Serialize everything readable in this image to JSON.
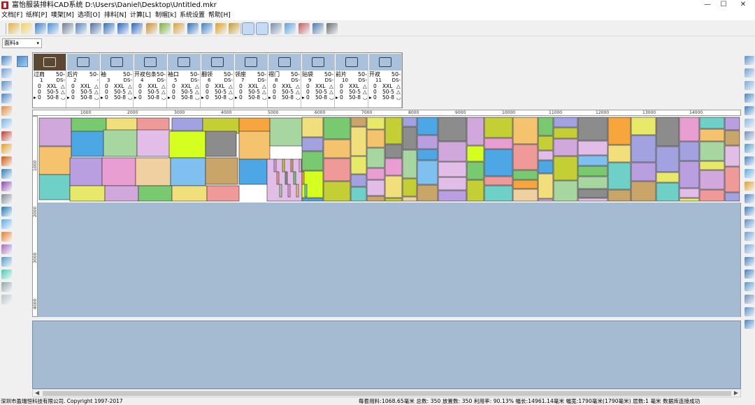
{
  "window": {
    "title": "富怡服装排料CAD系统 D:\\Users\\Daniel\\Desktop\\Untitled.mkr",
    "minimize": "—",
    "maximize": "☐",
    "close": "✕"
  },
  "menu": [
    {
      "label": "文档[F]"
    },
    {
      "label": "纸样[P]"
    },
    {
      "label": "唛架[M]"
    },
    {
      "label": "选项[O]"
    },
    {
      "label": "排料[N]"
    },
    {
      "label": "计算[L]"
    },
    {
      "label": "制帽[k]"
    },
    {
      "label": "系统设置"
    },
    {
      "label": "帮助[H]"
    }
  ],
  "toolbar": {
    "icons": [
      "open-folder-icon",
      "new-file-icon",
      "import-icon",
      "save-as-icon",
      "print-icon",
      "plot-icon",
      "print-preview-icon",
      "marker-settings-icon",
      "undo-icon",
      "redo-icon",
      "piece-tool-icon",
      "measure-icon",
      "tape-icon",
      "circle-icon",
      "table-icon",
      "text-icon",
      "image-icon",
      "view-single-icon",
      "view-double-icon",
      "grid-icon",
      "triangle-icon",
      "palette-icon",
      "export-icon",
      "delete-icon"
    ],
    "pressed": [
      17,
      18
    ]
  },
  "fabric_select": {
    "value": "面料a",
    "arrow": "▾"
  },
  "pieces": [
    {
      "name": "过肩",
      "size": "50-",
      "num": "1",
      "ds": "DS-",
      "qty": [
        [
          "0",
          "XXL",
          "△"
        ],
        [
          "0",
          "50-5",
          "△"
        ],
        [
          "0",
          "50-8",
          "◡"
        ]
      ]
    },
    {
      "name": "后片",
      "size": "50-",
      "num": "2",
      "ds": "-",
      "qty": [
        [
          "0",
          "XXL",
          "△"
        ],
        [
          "0",
          "50-5",
          "△"
        ],
        [
          "0",
          "50-8",
          "◡"
        ]
      ]
    },
    {
      "name": "袖",
      "size": "50-",
      "num": "3",
      "ds": "DS-",
      "qty": [
        [
          "0",
          "XXL",
          "△"
        ],
        [
          "0",
          "50-5",
          "△"
        ],
        [
          "0",
          "50-8",
          "◡"
        ]
      ]
    },
    {
      "name": "开衩包条",
      "size": "50-",
      "num": "4",
      "ds": "DS-",
      "qty": [
        [
          "0",
          "XXL",
          "△"
        ],
        [
          "0",
          "50-5",
          "△"
        ],
        [
          "0",
          "50-8",
          "◡"
        ]
      ]
    },
    {
      "name": "袖口",
      "size": "50-",
      "num": "5",
      "ds": "DS-",
      "qty": [
        [
          "0",
          "XXL",
          "△"
        ],
        [
          "0",
          "50-5",
          "△"
        ],
        [
          "0",
          "50-8",
          "◡"
        ]
      ]
    },
    {
      "name": "翻领",
      "size": "50-",
      "num": "6",
      "ds": "DS-",
      "qty": [
        [
          "0",
          "XXL",
          "△"
        ],
        [
          "0",
          "50-5",
          "△"
        ],
        [
          "0",
          "50-8",
          "◡"
        ]
      ]
    },
    {
      "name": "领座",
      "size": "50-",
      "num": "7",
      "ds": "DS-",
      "qty": [
        [
          "0",
          "XXL",
          "△"
        ],
        [
          "0",
          "50-5",
          "△"
        ],
        [
          "0",
          "50-8",
          "◡"
        ]
      ]
    },
    {
      "name": "褶门",
      "size": "50-",
      "num": "8",
      "ds": "DS-",
      "qty": [
        [
          "0",
          "XXL",
          "△"
        ],
        [
          "0",
          "50-5",
          "△"
        ],
        [
          "0",
          "50-8",
          "◡"
        ]
      ]
    },
    {
      "name": "贴袋",
      "size": "50-",
      "num": "9",
      "ds": "DS-",
      "qty": [
        [
          "0",
          "XXL",
          "△"
        ],
        [
          "0",
          "50-5",
          "△"
        ],
        [
          "0",
          "50-8",
          "◡"
        ]
      ]
    },
    {
      "name": "前片",
      "size": "50-",
      "num": "10",
      "ds": "DS-",
      "qty": [
        [
          "0",
          "XXL",
          "△"
        ],
        [
          "0",
          "50-5",
          "△"
        ],
        [
          "0",
          "50-8",
          "◡"
        ]
      ]
    },
    {
      "name": "开衩",
      "size": "50-",
      "num": "11",
      "ds": "DS-",
      "qty": [
        [
          "0",
          "XXL",
          "△"
        ],
        [
          "0",
          "50-5",
          "△"
        ],
        [
          "0",
          "50-8",
          "◡"
        ]
      ]
    }
  ],
  "ruler": {
    "horizontal": [
      "1000",
      "2000",
      "3000",
      "4000",
      "5000",
      "6000",
      "7000",
      "8000",
      "9000",
      "10000",
      "11000",
      "12000",
      "13000",
      "14000"
    ],
    "vertical": [
      "1000",
      "2000",
      "3000",
      "4000"
    ]
  },
  "status": {
    "copyright": "深圳市盈瑞恒科技有限公司. Copyright 1997-2017",
    "info": "每套用料:1068.65毫米 总数: 350 放置数: 350 利用率: 90.13% 幅长:14961.14毫米 幅宽:1790毫米(1790毫米) 层数:1 毫米   数据库连接成功"
  }
}
